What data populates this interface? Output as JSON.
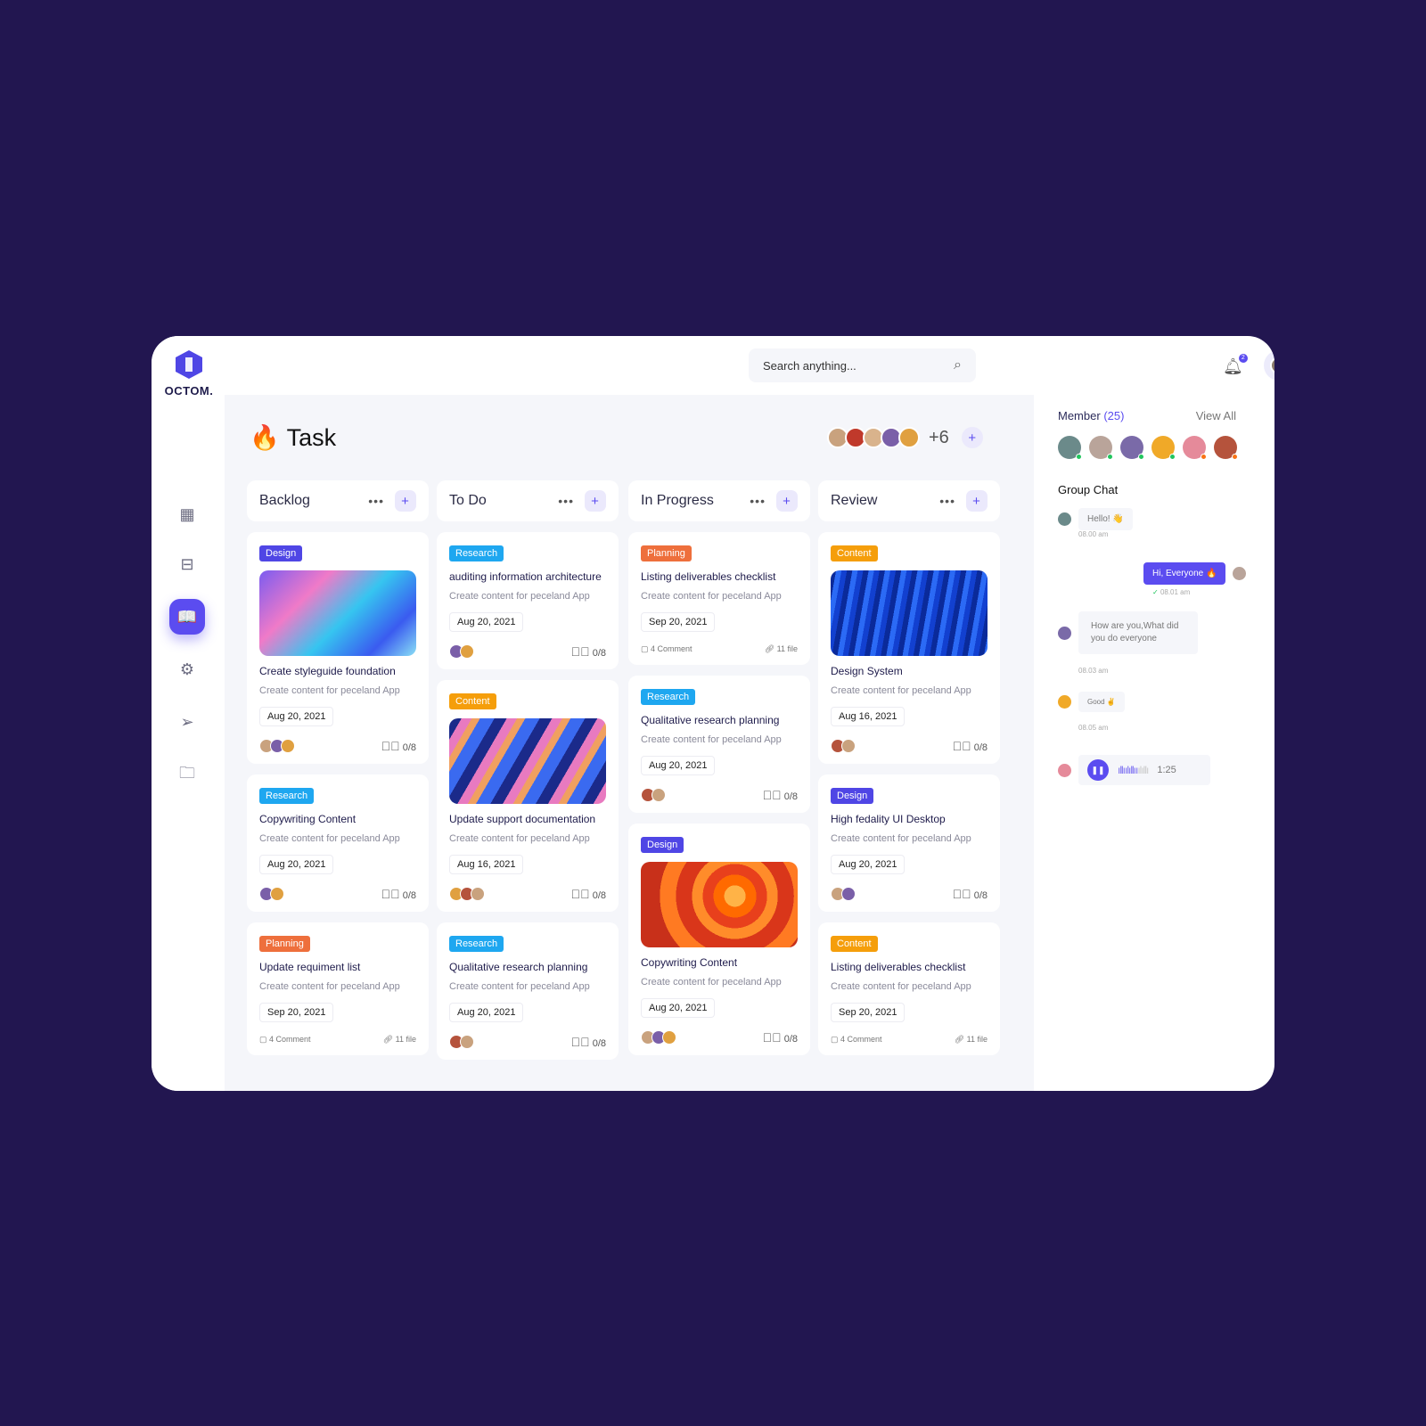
{
  "app": {
    "name": "OCTOM."
  },
  "search": {
    "placeholder": "Search anything..."
  },
  "notifications": {
    "count": "2"
  },
  "page": {
    "title": "Task",
    "title_emoji": "🔥",
    "team_extra": "+6"
  },
  "colors": {
    "accent": "#5b4cf0",
    "background": "#221650",
    "Design": "#4f46e5",
    "Research": "#1ea7f0",
    "Planning": "#ee6f3c",
    "Content": "#f59e0b"
  },
  "sidebar": {
    "items": [
      {
        "icon": "grid-icon"
      },
      {
        "icon": "layout-icon"
      },
      {
        "icon": "book-icon",
        "active": true
      },
      {
        "icon": "gear-icon"
      },
      {
        "icon": "send-icon"
      },
      {
        "icon": "folder-plus-icon"
      }
    ]
  },
  "columns": [
    {
      "name": "Backlog",
      "cards": [
        {
          "tag": "Design",
          "image": "abstract-blue-pink",
          "title": "Create styleguide foundation",
          "subtitle": "Create content for peceland App",
          "date": "Aug 20, 2021",
          "avatars": 3,
          "progress": "0/8"
        },
        {
          "tag": "Research",
          "title": "Copywriting Content",
          "subtitle": "Create content for peceland App",
          "date": "Aug 20, 2021",
          "avatars": 2,
          "progress": "0/8"
        },
        {
          "tag": "Planning",
          "title": "Update requiment list",
          "subtitle": "Create content for peceland App",
          "date": "Sep 20, 2021",
          "comments": "4 Comment",
          "files": "11 file"
        }
      ]
    },
    {
      "name": "To Do",
      "cards": [
        {
          "tag": "Research",
          "title": "auditing information architecture",
          "subtitle": "Create content for peceland App",
          "date": "Aug 20, 2021",
          "avatars": 2,
          "progress": "0/8"
        },
        {
          "tag": "Content",
          "image": "iridescent-waves",
          "title": "Update support documentation",
          "subtitle": "Create content for peceland App",
          "date": "Aug 16, 2021",
          "avatars": 3,
          "progress": "0/8"
        },
        {
          "tag": "Research",
          "title": "Qualitative research planning",
          "subtitle": "Create content for peceland App",
          "date": "Aug 20, 2021",
          "avatars": 2,
          "progress": "0/8"
        }
      ]
    },
    {
      "name": "In Progress",
      "cards": [
        {
          "tag": "Planning",
          "title": "Listing deliverables checklist",
          "subtitle": "Create content for peceland App",
          "date": "Sep 20, 2021",
          "comments": "4 Comment",
          "files": "11 file"
        },
        {
          "tag": "Research",
          "title": "Qualitative research planning",
          "subtitle": "Create content for peceland App",
          "date": "Aug 20, 2021",
          "avatars": 2,
          "progress": "0/8"
        },
        {
          "tag": "Design",
          "image": "orange-swirl",
          "title": "Copywriting Content",
          "subtitle": "Create content for peceland App",
          "date": "Aug 20, 2021",
          "avatars": 3,
          "progress": "0/8"
        }
      ]
    },
    {
      "name": "Review",
      "cards": [
        {
          "tag": "Content",
          "image": "blue-waves",
          "title": "Design System",
          "subtitle": "Create content for peceland App",
          "date": "Aug 16, 2021",
          "avatars": 2,
          "progress": "0/8"
        },
        {
          "tag": "Design",
          "title": "High fedality UI Desktop",
          "subtitle": "Create content for peceland App",
          "date": "Aug 20, 2021",
          "avatars": 2,
          "progress": "0/8"
        },
        {
          "tag": "Content",
          "title": "Listing deliverables checklist",
          "subtitle": "Create content for peceland App",
          "date": "Sep 20, 2021",
          "comments": "4 Comment",
          "files": "11 file"
        }
      ]
    }
  ],
  "members": {
    "label": "Member",
    "count": "(25)",
    "view_all": "View All"
  },
  "chat": {
    "title": "Group Chat",
    "messages": [
      {
        "text": "Hello! 👋",
        "time": "08.00 am"
      },
      {
        "text": "Hi, Everyone 🔥",
        "time": "08.01 am",
        "own": true
      },
      {
        "text": "How are you,What did you do everyone",
        "time": "08.03 am"
      },
      {
        "text": "Good ✌",
        "time": "08.05 am"
      },
      {
        "voice_duration": "1:25"
      }
    ]
  }
}
